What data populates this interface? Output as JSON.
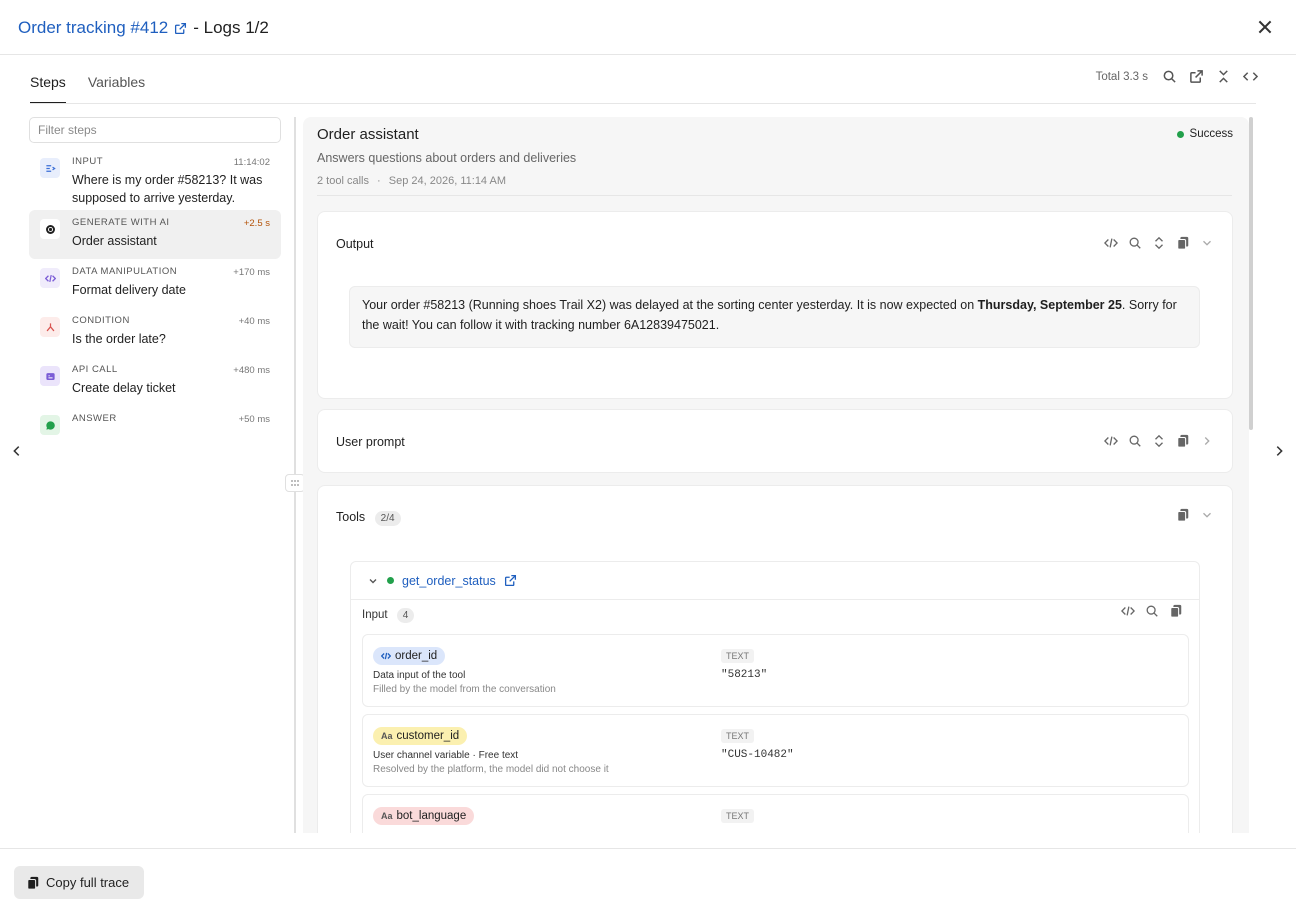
{
  "header": {
    "title_link": "Order tracking #412",
    "title_suffix": "- Logs 1/2"
  },
  "tabs": [
    {
      "label": "Steps",
      "active": true
    },
    {
      "label": "Variables",
      "active": false
    }
  ],
  "toolbar": {
    "total": "Total 3.3 s"
  },
  "filter": {
    "placeholder": "Filter steps"
  },
  "steps": [
    {
      "type": "INPUT",
      "time": "11:14:02",
      "label": "Where is my order #58213? It was supposed to arrive yesterday.",
      "icon": "input-icon",
      "color": "#e8eefc"
    },
    {
      "type": "GENERATE WITH AI",
      "time": "+2.5 s",
      "label": "Order assistant",
      "icon": "ai-icon",
      "color": "#ffffff"
    },
    {
      "type": "DATA MANIPULATION",
      "time": "+170 ms",
      "label": "Format delivery date",
      "icon": "code-icon",
      "color": "#f0ecfb"
    },
    {
      "type": "CONDITION",
      "time": "+40 ms",
      "label": "Is the order late?",
      "icon": "branch-icon",
      "color": "#fdecea"
    },
    {
      "type": "API CALL",
      "time": "+480 ms",
      "label": "Create delay ticket",
      "icon": "api-icon",
      "color": "#ebe4fb"
    },
    {
      "type": "ANSWER",
      "time": "+50 ms",
      "label": "",
      "icon": "chat-icon",
      "color": "#e3f5e6"
    }
  ],
  "node": {
    "title": "Order assistant",
    "description": "Answers questions about orders and deliveries",
    "meta_calls": "2 tool calls",
    "meta_date": "Sep 24, 2026, 11:14 AM",
    "status": "Success"
  },
  "output": {
    "title": "Output",
    "text_before": "Your order #58213 (Running shoes Trail X2) was delayed at the sorting center yesterday. It is now expected on ",
    "text_bold": "Thursday, September 25",
    "text_after": ". Sorry for the wait! You can follow it with tracking number 6A12839475021."
  },
  "user_prompt": {
    "title": "User prompt"
  },
  "tools": {
    "title": "Tools",
    "count": "2/4",
    "tool_name": "get_order_status",
    "input_label": "Input",
    "input_count": "4",
    "params": [
      {
        "name": "order_id",
        "kind": "code",
        "desc": "Data input of the tool",
        "sub": "Filled by the model from the conversation",
        "type": "TEXT",
        "value": "\"58213\""
      },
      {
        "name": "customer_id",
        "kind": "Aa",
        "desc": "User channel variable · Free text",
        "sub": "Resolved by the platform, the model did not choose it",
        "type": "TEXT",
        "value": "\"CUS-10482\""
      },
      {
        "name": "bot_language",
        "kind": "Aa",
        "desc": "",
        "sub": "",
        "type": "TEXT",
        "value": ""
      }
    ]
  },
  "footer": {
    "copy_label": "Copy full trace"
  }
}
